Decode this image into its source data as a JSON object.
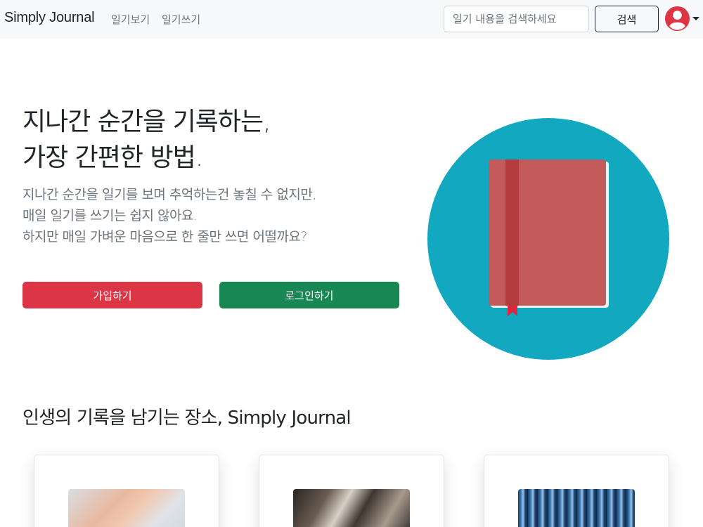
{
  "navbar": {
    "brand": "Simply Journal",
    "links": [
      "일기보기",
      "일기쓰기"
    ],
    "search": {
      "placeholder": "일기 내용을 검색하세요",
      "value": ""
    },
    "search_button": "검색",
    "profile_icon": "user-circle-icon"
  },
  "hero": {
    "title_lines": [
      "지나간 순간을 기록하는,",
      "가장 간편한 방법."
    ],
    "description_lines": [
      "지나간 순간을 일기를 보며 추억하는건 놓칠 수 없지만,",
      "매일 일기를 쓰기는 쉽지 않아요.",
      "하지만 매일 가벼운 마음으로 한 줄만 쓰면 어떨까요?"
    ],
    "signup_button": "가입하기",
    "login_button": "로그인하기",
    "illustration_icon": "book-icon"
  },
  "section": {
    "title": "인생의 기록을 남기는 장소, Simply Journal"
  },
  "colors": {
    "navbar_bg": "#f8f9fa",
    "danger": "#dc3545",
    "success": "#198754",
    "circle": "#11a8c0",
    "book": "#c55a5a",
    "avatar": "#dc3545"
  }
}
